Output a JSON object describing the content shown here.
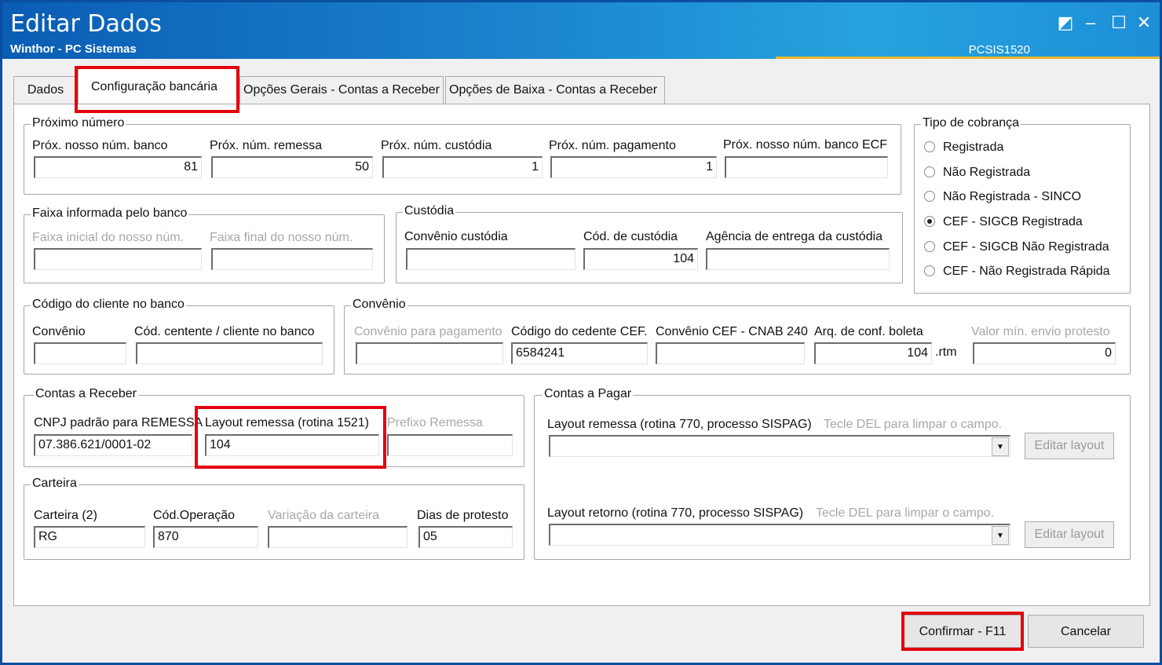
{
  "window": {
    "title": "Editar Dados",
    "subtitle": "Winthor - PC Sistemas",
    "code": "PCSIS1520",
    "controls": [
      "◩",
      "‒",
      "☐",
      "✕"
    ]
  },
  "tabs": [
    "Dados",
    "Configuração bancária",
    "Opções Gerais - Contas a Receber",
    "Opções de Baixa - Contas a Receber"
  ],
  "proximo": {
    "legend": "Próximo número",
    "labels": [
      "Próx. nosso núm. banco",
      "Próx. núm. remessa",
      "Próx. núm. custódia",
      "Próx. núm. pagamento",
      "Próx. nosso núm. banco ECF"
    ],
    "values": [
      "81",
      "50",
      "1",
      "1",
      ""
    ]
  },
  "tipo": {
    "legend": "Tipo de cobrança",
    "options": [
      "Registrada",
      "Não Registrada",
      "Não Registrada - SINCO",
      "CEF - SIGCB Registrada",
      "CEF - SIGCB Não Registrada",
      "CEF - Não Registrada Rápida"
    ],
    "selected": "CEF - SIGCB Registrada"
  },
  "faixa": {
    "legend": "Faixa informada pelo banco",
    "labels": [
      "Faixa inicial do nosso núm.",
      "Faixa final do nosso núm."
    ],
    "values": [
      "",
      ""
    ]
  },
  "custodia": {
    "legend": "Custódia",
    "labels": [
      "Convênio custódia",
      "Cód. de custódia",
      "Agência de entrega da custódia"
    ],
    "values": [
      "",
      "104",
      ""
    ]
  },
  "codcliente": {
    "legend": "Código do cliente no banco",
    "labels": [
      "Convênio",
      "Cód. centente / cliente no banco"
    ],
    "values": [
      "",
      ""
    ]
  },
  "convenio": {
    "legend": "Convênio",
    "labels": [
      "Convênio para pagamento",
      "Código do cedente CEF.",
      "Convênio CEF - CNAB 240",
      "Arq. de conf. boleta",
      "Valor mín. envio protesto"
    ],
    "values": [
      "",
      "6584241",
      "",
      "104",
      "0"
    ],
    "suffix": ".rtm"
  },
  "receber": {
    "legend": "Contas a Receber",
    "labels": [
      "CNPJ padrão para REMESSA",
      "Layout remessa (rotina 1521)",
      "Prefixo Remessa"
    ],
    "values": [
      "07.386.621/0001-02",
      "104",
      ""
    ]
  },
  "carteira": {
    "legend": "Carteira",
    "labels": [
      "Carteira (2)",
      "Cód.Operação",
      "Variação da carteira",
      "Dias de protesto"
    ],
    "values": [
      "RG",
      "870",
      "",
      "05"
    ]
  },
  "pagar": {
    "legend": "Contas a Pagar",
    "remessa_label": "Layout remessa (rotina 770, processo SISPAG)",
    "remessa_hint": "Tecle DEL para limpar o campo.",
    "retorno_label": "Layout retorno (rotina 770, processo SISPAG)",
    "retorno_hint": "Tecle DEL para limpar o campo.",
    "edit_label": "Editar layout",
    "dropdown_icon": "▼"
  },
  "footer": {
    "confirm": "Confirmar - F11",
    "cancel": "Cancelar"
  }
}
